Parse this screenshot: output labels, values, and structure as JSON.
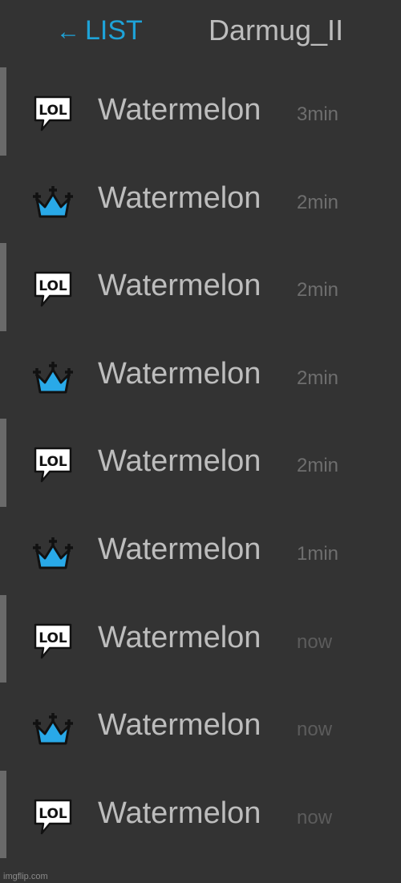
{
  "header": {
    "back_arrow": "←",
    "back_label": "LIST",
    "title": "Darmug_II"
  },
  "colors": {
    "background": "#333333",
    "accent_link": "#1ea3d8",
    "crown": "#29a9e8",
    "row_marker": "#6a6a6a"
  },
  "list": {
    "items": [
      {
        "icon": "lol-speech-bubble-icon",
        "name": "Watermelon",
        "time": "3min",
        "marked": true
      },
      {
        "icon": "crown-icon",
        "name": "Watermelon",
        "time": "2min",
        "marked": false
      },
      {
        "icon": "lol-speech-bubble-icon",
        "name": "Watermelon",
        "time": "2min",
        "marked": true
      },
      {
        "icon": "crown-icon",
        "name": "Watermelon",
        "time": "2min",
        "marked": false
      },
      {
        "icon": "lol-speech-bubble-icon",
        "name": "Watermelon",
        "time": "2min",
        "marked": true
      },
      {
        "icon": "crown-icon",
        "name": "Watermelon",
        "time": "1min",
        "marked": false
      },
      {
        "icon": "lol-speech-bubble-icon",
        "name": "Watermelon",
        "time": "now",
        "marked": true
      },
      {
        "icon": "crown-icon",
        "name": "Watermelon",
        "time": "now",
        "marked": false
      },
      {
        "icon": "lol-speech-bubble-icon",
        "name": "Watermelon",
        "time": "now",
        "marked": true
      }
    ]
  },
  "watermark": "imgflip.com"
}
